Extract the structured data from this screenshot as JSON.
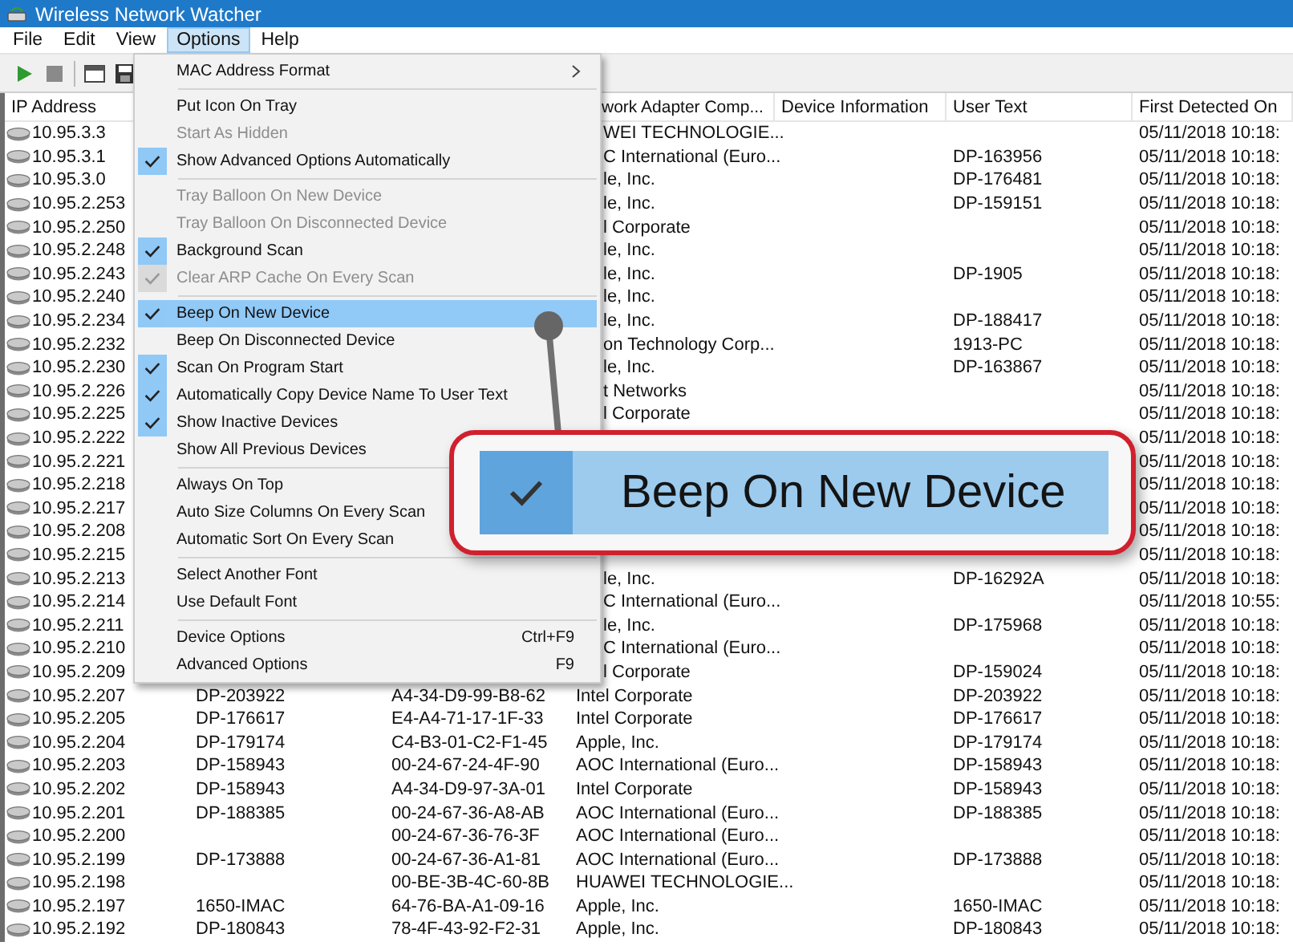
{
  "window": {
    "title": "Wireless Network Watcher"
  },
  "menu_bar": [
    {
      "label": "File",
      "selected": false
    },
    {
      "label": "Edit",
      "selected": false
    },
    {
      "label": "View",
      "selected": false
    },
    {
      "label": "Options",
      "selected": true
    },
    {
      "label": "Help",
      "selected": false
    }
  ],
  "table": {
    "columns": [
      {
        "label": "IP Address"
      },
      {},
      {},
      {
        "label": "work Adapter Comp..."
      },
      {
        "label": "Device Information"
      },
      {
        "label": "User Text"
      },
      {
        "label": "First Detected On"
      }
    ],
    "rows": [
      {
        "cells": [
          "10.95.3.3",
          null,
          null,
          "WEI TECHNOLOGIE...",
          null,
          null,
          "05/11/2018 10:18:"
        ]
      },
      {
        "cells": [
          "10.95.3.1",
          null,
          null,
          "C International (Euro...",
          null,
          "DP-163956",
          "05/11/2018 10:18:"
        ]
      },
      {
        "cells": [
          "10.95.3.0",
          null,
          null,
          "le, Inc.",
          null,
          "DP-176481",
          "05/11/2018 10:18:"
        ]
      },
      {
        "cells": [
          "10.95.2.253",
          null,
          null,
          "le, Inc.",
          null,
          "DP-159151",
          "05/11/2018 10:18:"
        ]
      },
      {
        "cells": [
          "10.95.2.250",
          null,
          null,
          "l Corporate",
          null,
          null,
          "05/11/2018 10:18:"
        ]
      },
      {
        "cells": [
          "10.95.2.248",
          null,
          null,
          "le, Inc.",
          null,
          null,
          "05/11/2018 10:18:"
        ]
      },
      {
        "cells": [
          "10.95.2.243",
          null,
          null,
          "le, Inc.",
          null,
          "DP-1905",
          "05/11/2018 10:18:"
        ]
      },
      {
        "cells": [
          "10.95.2.240",
          null,
          null,
          "le, Inc.",
          null,
          null,
          "05/11/2018 10:18:"
        ]
      },
      {
        "cells": [
          "10.95.2.234",
          null,
          null,
          "le, Inc.",
          null,
          "DP-188417",
          "05/11/2018 10:18:"
        ]
      },
      {
        "cells": [
          "10.95.2.232",
          null,
          null,
          "on Technology Corp...",
          null,
          "1913-PC",
          "05/11/2018 10:18:"
        ]
      },
      {
        "cells": [
          "10.95.2.230",
          null,
          null,
          "le, Inc.",
          null,
          "DP-163867",
          "05/11/2018 10:18:"
        ]
      },
      {
        "cells": [
          "10.95.2.226",
          null,
          null,
          "t Networks",
          null,
          null,
          "05/11/2018 10:18:"
        ]
      },
      {
        "cells": [
          "10.95.2.225",
          null,
          null,
          "l Corporate",
          null,
          null,
          "05/11/2018 10:18:"
        ]
      },
      {
        "cells": [
          "10.95.2.222",
          null,
          null,
          null,
          null,
          null,
          "05/11/2018 10:18:"
        ]
      },
      {
        "cells": [
          "10.95.2.221",
          null,
          null,
          null,
          null,
          null,
          "05/11/2018 10:18:"
        ]
      },
      {
        "cells": [
          "10.95.2.218",
          null,
          null,
          null,
          null,
          null,
          "05/11/2018 10:18:"
        ]
      },
      {
        "cells": [
          "10.95.2.217",
          null,
          null,
          null,
          null,
          null,
          "05/11/2018 10:18:"
        ]
      },
      {
        "cells": [
          "10.95.2.208",
          null,
          null,
          null,
          null,
          null,
          "05/11/2018 10:18:"
        ]
      },
      {
        "cells": [
          "10.95.2.215",
          null,
          null,
          null,
          null,
          null,
          "05/11/2018 10:18:"
        ]
      },
      {
        "cells": [
          "10.95.2.213",
          null,
          null,
          "le, Inc.",
          null,
          "DP-16292A",
          "05/11/2018 10:18:"
        ]
      },
      {
        "cells": [
          "10.95.2.214",
          null,
          null,
          "C International (Euro...",
          null,
          null,
          "05/11/2018 10:55:"
        ]
      },
      {
        "cells": [
          "10.95.2.211",
          null,
          null,
          "le, Inc.",
          null,
          "DP-175968",
          "05/11/2018 10:18:"
        ]
      },
      {
        "cells": [
          "10.95.2.210",
          null,
          null,
          "C International (Euro...",
          null,
          null,
          "05/11/2018 10:18:"
        ]
      },
      {
        "cells": [
          "10.95.2.209",
          null,
          null,
          "l Corporate",
          null,
          "DP-159024",
          "05/11/2018 10:18:"
        ]
      },
      {
        "cells": [
          "10.95.2.207",
          "DP-203922",
          "A4-34-D9-99-B8-62",
          "Intel Corporate",
          null,
          "DP-203922",
          "05/11/2018 10:18:"
        ]
      },
      {
        "cells": [
          "10.95.2.205",
          "DP-176617",
          "E4-A4-71-17-1F-33",
          "Intel Corporate",
          null,
          "DP-176617",
          "05/11/2018 10:18:"
        ]
      },
      {
        "cells": [
          "10.95.2.204",
          "DP-179174",
          "C4-B3-01-C2-F1-45",
          "Apple, Inc.",
          null,
          "DP-179174",
          "05/11/2018 10:18:"
        ]
      },
      {
        "cells": [
          "10.95.2.203",
          "DP-158943",
          "00-24-67-24-4F-90",
          "AOC International (Euro...",
          null,
          "DP-158943",
          "05/11/2018 10:18:"
        ]
      },
      {
        "cells": [
          "10.95.2.202",
          "DP-158943",
          "A4-34-D9-97-3A-01",
          "Intel Corporate",
          null,
          "DP-158943",
          "05/11/2018 10:18:"
        ]
      },
      {
        "cells": [
          "10.95.2.201",
          "DP-188385",
          "00-24-67-36-A8-AB",
          "AOC International (Euro...",
          null,
          "DP-188385",
          "05/11/2018 10:18:"
        ]
      },
      {
        "cells": [
          "10.95.2.200",
          null,
          "00-24-67-36-76-3F",
          "AOC International (Euro...",
          null,
          null,
          "05/11/2018 10:18:"
        ]
      },
      {
        "cells": [
          "10.95.2.199",
          "DP-173888",
          "00-24-67-36-A1-81",
          "AOC International (Euro...",
          null,
          "DP-173888",
          "05/11/2018 10:18:"
        ]
      },
      {
        "cells": [
          "10.95.2.198",
          null,
          "00-BE-3B-4C-60-8B",
          "HUAWEI TECHNOLOGIE...",
          null,
          null,
          "05/11/2018 10:18:"
        ]
      },
      {
        "cells": [
          "10.95.2.197",
          "1650-IMAC",
          "64-76-BA-A1-09-16",
          "Apple, Inc.",
          null,
          "1650-IMAC",
          "05/11/2018 10:18:"
        ]
      },
      {
        "cells": [
          "10.95.2.192",
          "DP-180843",
          "78-4F-43-92-F2-31",
          "Apple, Inc.",
          null,
          "DP-180843",
          "05/11/2018 10:18:"
        ]
      }
    ]
  },
  "options_menu": [
    {
      "kind": "item",
      "label": "MAC Address Format",
      "submenu": true,
      "checked": false,
      "disabled": false,
      "selected": false
    },
    {
      "kind": "separator"
    },
    {
      "kind": "item",
      "label": "Put Icon On Tray",
      "checked": false,
      "disabled": false,
      "selected": false
    },
    {
      "kind": "item",
      "label": "Start As Hidden",
      "checked": false,
      "disabled": true,
      "selected": false
    },
    {
      "kind": "item",
      "label": "Show Advanced Options Automatically",
      "checked": true,
      "disabled": false,
      "selected": false
    },
    {
      "kind": "separator"
    },
    {
      "kind": "item",
      "label": "Tray Balloon On New Device",
      "checked": false,
      "disabled": true,
      "selected": false
    },
    {
      "kind": "item",
      "label": "Tray Balloon On Disconnected Device",
      "checked": false,
      "disabled": true,
      "selected": false
    },
    {
      "kind": "item",
      "label": "Background Scan",
      "checked": true,
      "disabled": false,
      "selected": false
    },
    {
      "kind": "item",
      "label": "Clear ARP Cache On Every Scan",
      "checked": true,
      "disabled": true,
      "selected": false
    },
    {
      "kind": "separator"
    },
    {
      "kind": "item",
      "label": "Beep On New Device",
      "checked": true,
      "disabled": false,
      "selected": true
    },
    {
      "kind": "item",
      "label": "Beep On Disconnected Device",
      "checked": false,
      "disabled": false,
      "selected": false
    },
    {
      "kind": "item",
      "label": "Scan On Program Start",
      "checked": true,
      "disabled": false,
      "selected": false
    },
    {
      "kind": "item",
      "label": "Automatically Copy Device Name To User Text",
      "checked": true,
      "disabled": false,
      "selected": false
    },
    {
      "kind": "item",
      "label": "Show Inactive Devices",
      "checked": true,
      "disabled": false,
      "selected": false
    },
    {
      "kind": "item",
      "label": "Show All Previous Devices",
      "checked": false,
      "disabled": false,
      "selected": false
    },
    {
      "kind": "separator"
    },
    {
      "kind": "item",
      "label": "Always On Top",
      "checked": false,
      "disabled": false,
      "selected": false
    },
    {
      "kind": "item",
      "label": "Auto Size Columns On Every Scan",
      "checked": false,
      "disabled": false,
      "selected": false
    },
    {
      "kind": "item",
      "label": "Automatic Sort On Every Scan",
      "checked": false,
      "disabled": false,
      "selected": false
    },
    {
      "kind": "separator"
    },
    {
      "kind": "item",
      "label": "Select Another Font",
      "checked": false,
      "disabled": false,
      "selected": false
    },
    {
      "kind": "item",
      "label": "Use Default Font",
      "checked": false,
      "disabled": false,
      "selected": false
    },
    {
      "kind": "separator"
    },
    {
      "kind": "item",
      "label": "Device Options",
      "shortcut": "Ctrl+F9",
      "checked": false,
      "disabled": false,
      "selected": false
    },
    {
      "kind": "item",
      "label": "Advanced Options",
      "shortcut": "F9",
      "checked": false,
      "disabled": false,
      "selected": false
    }
  ],
  "callout": {
    "label": "Beep On New Device",
    "checked": true
  }
}
